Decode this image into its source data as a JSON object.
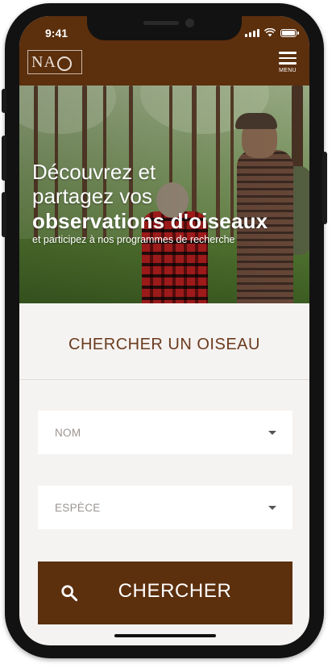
{
  "status_bar": {
    "time": "9:41",
    "icons": [
      "signal-icon",
      "wifi-icon",
      "battery-icon"
    ]
  },
  "header": {
    "logo_text": "NA",
    "logo_icon": "ring-logo-icon",
    "menu_label": "MENU",
    "menu_icon": "hamburger-icon"
  },
  "hero": {
    "line1": "Découvrez et",
    "line2": "partagez vos",
    "line3": "observations d'oiseaux",
    "subtitle": "et participez à nos programmes de recherche"
  },
  "search": {
    "title": "CHERCHER UN OISEAU",
    "fields": [
      {
        "label": "NOM",
        "icon": "chevron-down-icon"
      },
      {
        "label": "ESPÈCE",
        "icon": "chevron-down-icon"
      }
    ],
    "button_label": "CHERCHER",
    "button_icon": "search-icon"
  },
  "colors": {
    "brand_brown": "#5c2f0d",
    "title_brown": "#6b3b1f",
    "background": "#f5f3f1",
    "field_bg": "#ffffff",
    "placeholder": "#9b9591"
  }
}
